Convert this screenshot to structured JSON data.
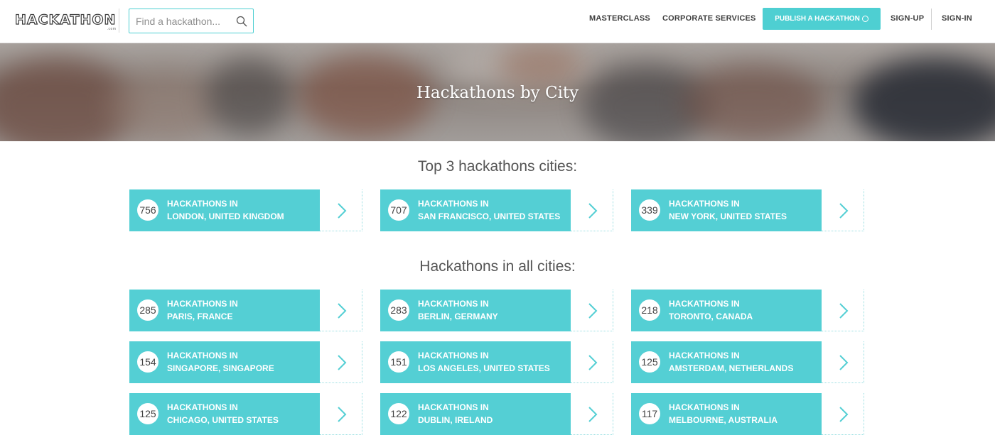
{
  "header": {
    "logo_text": "HACKATHON",
    "logo_sub": ".com",
    "search_placeholder": "Find a hackathon...",
    "nav": {
      "masterclass": "MASTERCLASS",
      "corporate": "CORPORATE SERVICES",
      "publish": "PUBLISH A HACKATHON",
      "signup": "SIGN-UP",
      "signin": "SIGN-IN"
    }
  },
  "hero": {
    "title": "Hackathons by City"
  },
  "top": {
    "title": "Top 3 hackathons cities:",
    "cards": [
      {
        "count": "756",
        "prefix": "HACKATHONS IN",
        "city": "LONDON, UNITED KINGDOM"
      },
      {
        "count": "707",
        "prefix": "HACKATHONS IN",
        "city": "SAN FRANCISCO, UNITED STATES"
      },
      {
        "count": "339",
        "prefix": "HACKATHONS IN",
        "city": "NEW YORK, UNITED STATES"
      }
    ]
  },
  "all": {
    "title": "Hackathons in all cities:",
    "cards": [
      {
        "count": "285",
        "prefix": "HACKATHONS IN",
        "city": "PARIS, FRANCE"
      },
      {
        "count": "283",
        "prefix": "HACKATHONS IN",
        "city": "BERLIN, GERMANY"
      },
      {
        "count": "218",
        "prefix": "HACKATHONS IN",
        "city": "TORONTO, CANADA"
      },
      {
        "count": "154",
        "prefix": "HACKATHONS IN",
        "city": "SINGAPORE, SINGAPORE"
      },
      {
        "count": "151",
        "prefix": "HACKATHONS IN",
        "city": "LOS ANGELES, UNITED STATES"
      },
      {
        "count": "125",
        "prefix": "HACKATHONS IN",
        "city": "AMSTERDAM, NETHERLANDS"
      },
      {
        "count": "125",
        "prefix": "HACKATHONS IN",
        "city": "CHICAGO, UNITED STATES"
      },
      {
        "count": "122",
        "prefix": "HACKATHONS IN",
        "city": "DUBLIN, IRELAND"
      },
      {
        "count": "117",
        "prefix": "HACKATHONS IN",
        "city": "MELBOURNE, AUSTRALIA"
      }
    ]
  },
  "colors": {
    "accent": "#54cfd4",
    "nav_text": "#3f3f3f"
  }
}
